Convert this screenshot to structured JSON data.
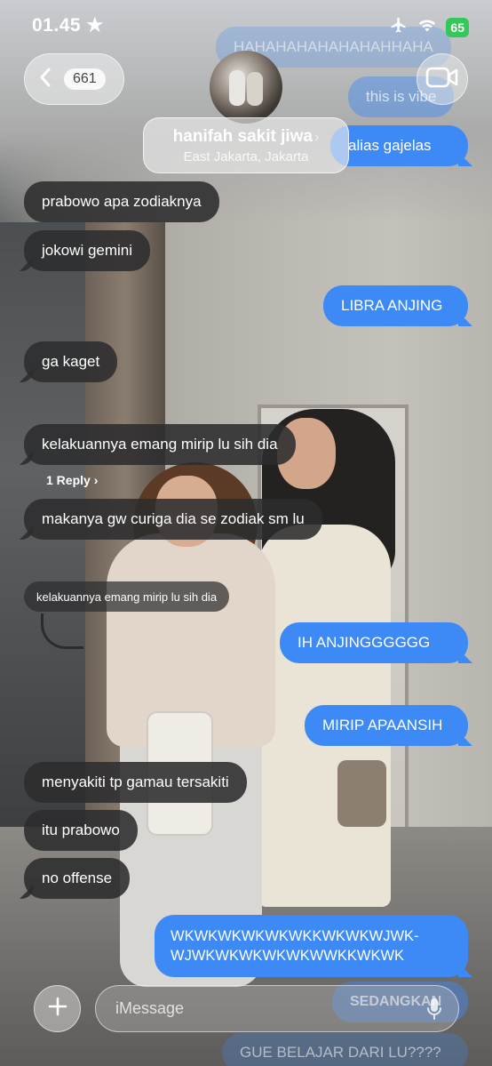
{
  "status_bar": {
    "time": "01.45",
    "battery": "65"
  },
  "header": {
    "back_count": "661",
    "contact_name": "hanifah sakit jiwa",
    "contact_location": "East Jakarta, Jakarta"
  },
  "messages": {
    "top_faded_1": "HAHAHAHAHAHAHAHHAHA",
    "top_faded_2": "this is vibe",
    "top_faded_3": "alias gajelas",
    "m1": "prabowo apa zodiaknya",
    "m2": "jokowi gemini",
    "m3": "LIBRA ANJING",
    "m4": "ga kaget",
    "m5": "kelakuannya emang mirip lu sih dia",
    "reply_link": "1 Reply",
    "m6": "makanya gw curiga dia se zodiak sm lu",
    "quoted": "kelakuannya emang mirip lu sih dia",
    "m7": "IH ANJINGGGGGG",
    "m8": "MIRIP APAANSIH",
    "m9": "menyakiti tp gamau tersakiti",
    "m10": "itu prabowo",
    "m11": "no offense",
    "m12_line1": "WKWKWKWKWKWKKWKWKWJWK-",
    "m12_line2": "WJWKWKWKWKWKWWKKWKWK",
    "bottom_faded_1": "SEDANGKAN",
    "bottom_faded_2": "GUE BELAJAR DARI LU????"
  },
  "composer": {
    "placeholder": "iMessage"
  },
  "colors": {
    "outgoing": "#3d8af7",
    "incoming": "#2c2c2e",
    "battery": "#34c759"
  },
  "icons": [
    "airplane-icon",
    "wifi-icon",
    "battery-icon",
    "chevron-left-icon",
    "video-icon",
    "plus-icon",
    "mic-icon"
  ]
}
